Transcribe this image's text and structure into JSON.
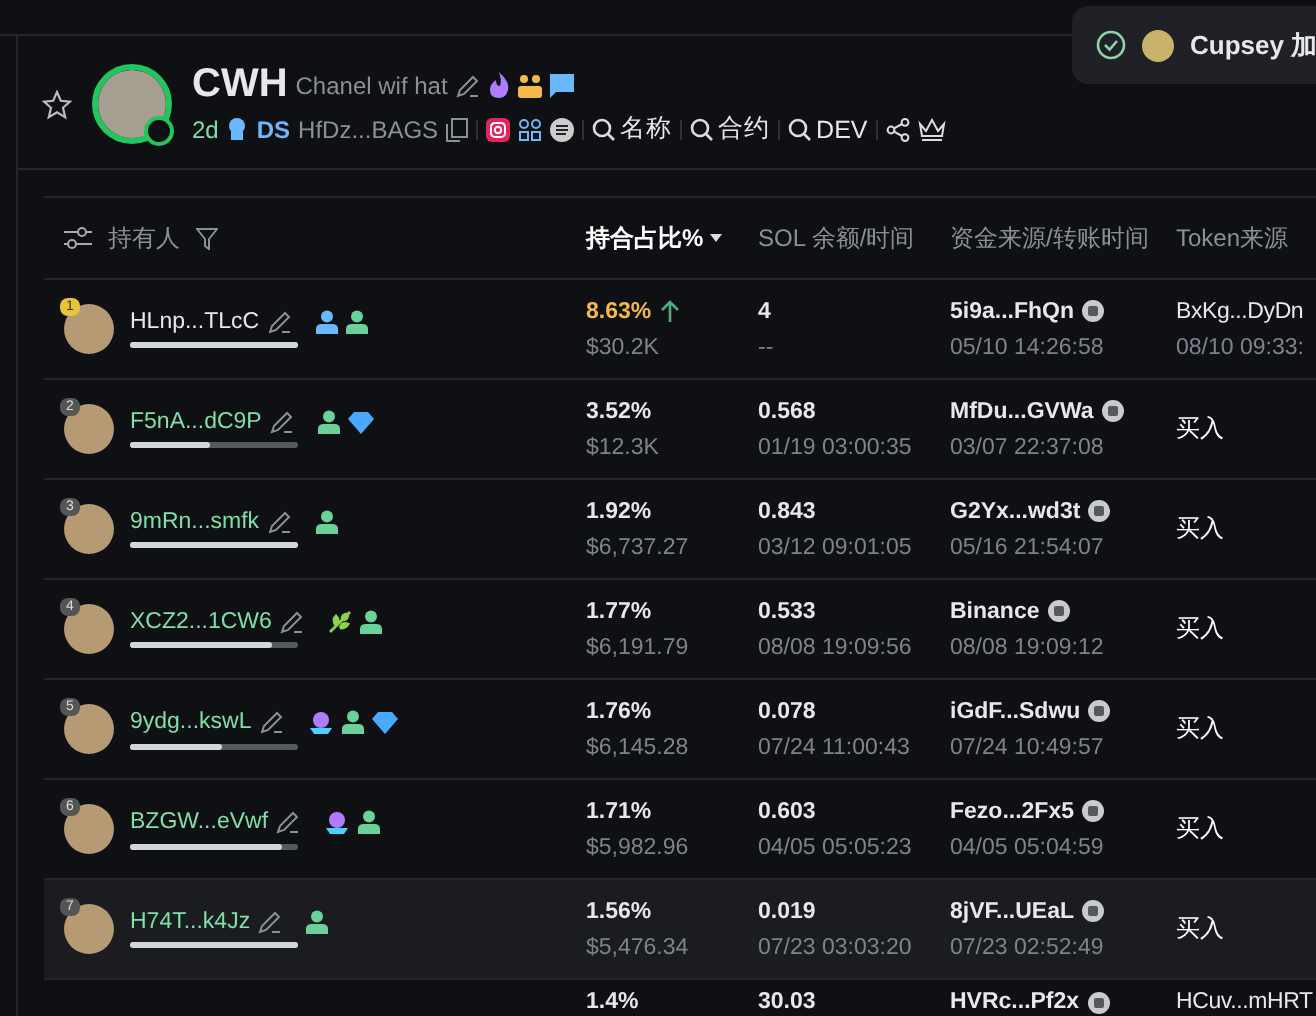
{
  "toast": {
    "name": "Cupsey 加"
  },
  "token": {
    "symbol": "CWH",
    "name": "Chanel wif hat",
    "age": "2d",
    "dex": "DS",
    "address": "HfDz...BAGS",
    "searches": [
      "名称",
      "合约",
      "DEV"
    ]
  },
  "table": {
    "columns": [
      {
        "label": "持有人",
        "sorted": false
      },
      {
        "label": "持合占比%",
        "sorted": true
      },
      {
        "label": "SOL 余额/时间",
        "sorted": false
      },
      {
        "label": "资金来源/转账时间",
        "sorted": false
      },
      {
        "label": "Token来源",
        "sorted": false
      }
    ],
    "rows": [
      {
        "rank": "1",
        "holder": "HLnp...TLcC",
        "color": "#e6e8ea",
        "level": 1.0,
        "tags": [
          {
            "kind": "user-blue"
          },
          {
            "kind": "user-green"
          }
        ],
        "pct": "8.63%",
        "rising": true,
        "value": "$30.2K",
        "sol": "4",
        "sol_time": "--",
        "source": "5i9a...FhQn",
        "source_time": "05/10 14:26:58",
        "token_source": "BxKg...DyDn",
        "token_time": "08/10 09:33:",
        "selected": false
      },
      {
        "rank": "2",
        "holder": "F5nA...dC9P",
        "color": "#7fe0a8",
        "level": 0.48,
        "tags": [
          {
            "kind": "user-green"
          },
          {
            "kind": "diamond"
          }
        ],
        "pct": "3.52%",
        "rising": false,
        "value": "$12.3K",
        "sol": "0.568",
        "sol_time": "01/19 03:00:35",
        "source": "MfDu...GVWa",
        "source_time": "03/07 22:37:08",
        "token_source": "买入",
        "selected": false
      },
      {
        "rank": "3",
        "holder": "9mRn...smfk",
        "color": "#7fe0a8",
        "level": 1.0,
        "tags": [
          {
            "kind": "user-green"
          }
        ],
        "pct": "1.92%",
        "rising": false,
        "value": "$6,737.27",
        "sol": "0.843",
        "sol_time": "03/12 09:01:05",
        "source": "G2Yx...wd3t",
        "source_time": "05/16 21:54:07",
        "token_source": "买入",
        "selected": false
      },
      {
        "rank": "4",
        "holder": "XCZ2...1CW6",
        "color": "#7fe0a8",
        "level": 0.84,
        "tags": [
          {
            "kind": "leaf"
          },
          {
            "kind": "user-green"
          }
        ],
        "pct": "1.77%",
        "rising": false,
        "value": "$6,191.79",
        "sol": "0.533",
        "sol_time": "08/08 19:09:56",
        "source": "Binance",
        "source_time": "08/08 19:09:12",
        "token_source": "买入",
        "selected": false
      },
      {
        "rank": "5",
        "holder": "9ydg...kswL",
        "color": "#7fe0a8",
        "level": 0.55,
        "tags": [
          {
            "kind": "ufo"
          },
          {
            "kind": "user-green"
          },
          {
            "kind": "diamond"
          }
        ],
        "pct": "1.76%",
        "rising": false,
        "value": "$6,145.28",
        "sol": "0.078",
        "sol_time": "07/24 11:00:43",
        "source": "iGdF...Sdwu",
        "source_time": "07/24 10:49:57",
        "token_source": "买入",
        "selected": false
      },
      {
        "rank": "6",
        "holder": "BZGW...eVwf",
        "color": "#7fe0a8",
        "level": 0.9,
        "tags": [
          {
            "kind": "ufo"
          },
          {
            "kind": "user-green"
          }
        ],
        "pct": "1.71%",
        "rising": false,
        "value": "$5,982.96",
        "sol": "0.603",
        "sol_time": "04/05 05:05:23",
        "source": "Fezo...2Fx5",
        "source_time": "04/05 05:04:59",
        "token_source": "买入",
        "selected": false
      },
      {
        "rank": "7",
        "holder": "H74T...k4Jz",
        "color": "#7fe0a8",
        "level": 1.0,
        "tags": [
          {
            "kind": "user-green"
          }
        ],
        "pct": "1.56%",
        "rising": false,
        "value": "$5,476.34",
        "sol": "0.019",
        "sol_time": "07/23 03:03:20",
        "source": "8jVF...UEaL",
        "source_time": "07/23 02:52:49",
        "token_source": "买入",
        "selected": true
      },
      {
        "pct": "1.4%",
        "sol": "30.03",
        "source": "HVRc...Pf2x",
        "token_source": "HCuv...mHRT",
        "selected": false
      }
    ]
  }
}
